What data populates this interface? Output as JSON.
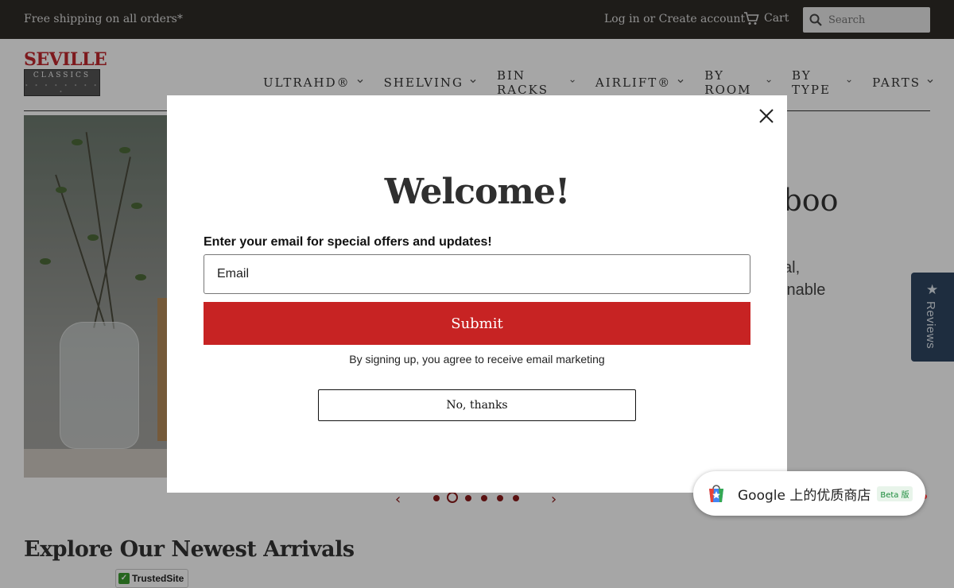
{
  "topbar": {
    "shipping": "Free shipping on all orders*",
    "login": "Log in or Create account",
    "cart": "Cart",
    "search_placeholder": "Search"
  },
  "logo": {
    "line1": "SEVILLE",
    "line2": "CLASSICS"
  },
  "nav": {
    "items": [
      "ULTRAHD®",
      "SHELVING",
      "BIN RACKS",
      "AIRLIFT®",
      "BY ROOM",
      "BY TYPE",
      "PARTS"
    ]
  },
  "hero": {
    "title_fragment": "nboo",
    "sub1_fragment": "al,",
    "sub2_fragment": "inable"
  },
  "slider": {
    "slide_count": 6,
    "active_index": 1
  },
  "explore_title": "Explore Our Newest Arrivals",
  "trusted": "TrustedSite",
  "reviews_tab": "Reviews",
  "modal": {
    "title": "Welcome!",
    "label": "Enter your email for special offers and updates!",
    "email_placeholder": "Email",
    "submit": "Submit",
    "note": "By signing up, you agree to receive email marketing",
    "no_thanks": "No, thanks"
  },
  "google_badge": {
    "text": "Google 上的优质商店",
    "beta": "Beta 版"
  },
  "colors": {
    "accent": "#c72323",
    "topbar": "#2f2b27",
    "reviews": "#2e4561"
  }
}
